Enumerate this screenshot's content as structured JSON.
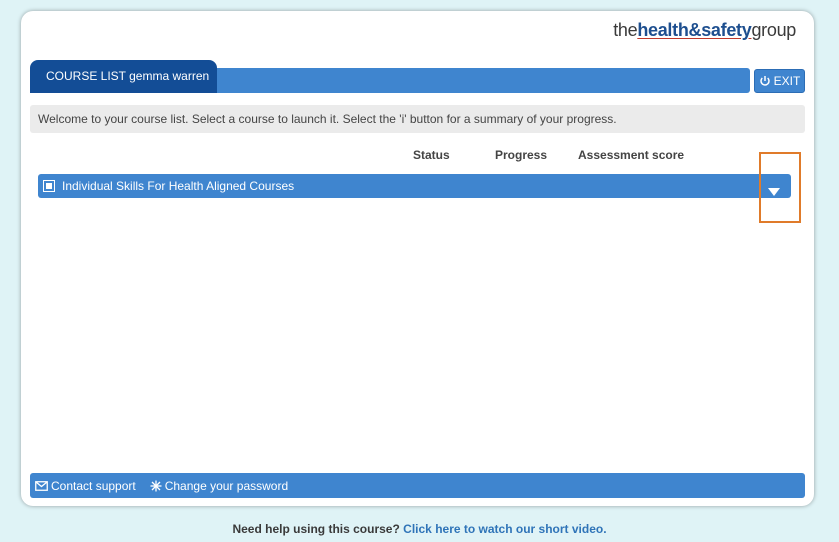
{
  "brand": {
    "logo_prefix": "the",
    "logo_main": "health&safety",
    "logo_suffix": "group"
  },
  "header": {
    "tab_label": "COURSE LIST gemma warren",
    "exit_label": "EXIT"
  },
  "welcome_text": "Welcome to your course list. Select a course to launch it. Select the 'i' button for a summary of your progress.",
  "columns": {
    "status": "Status",
    "progress": "Progress",
    "assessment": "Assessment score"
  },
  "courses": [
    {
      "title": "Individual Skills For Health Aligned Courses"
    }
  ],
  "footer": {
    "contact": "Contact support",
    "password": "Change your password"
  },
  "help": {
    "question": "Need help using this course?",
    "link": "Click here to watch our short video."
  },
  "colors": {
    "primary_blue": "#3f85cf",
    "dark_blue": "#134d96",
    "highlight_orange": "#e07b2a"
  }
}
